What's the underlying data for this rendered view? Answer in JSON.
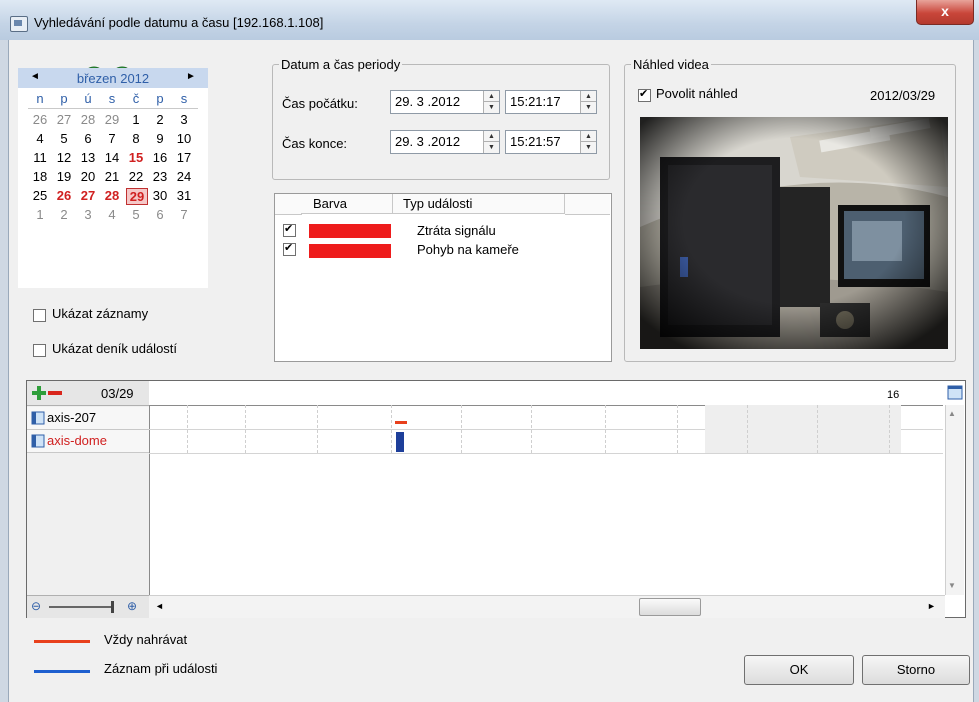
{
  "window": {
    "title": "Vyhledávání podle datumu a času [192.168.1.108]",
    "close_label": "x"
  },
  "toolbar": {
    "icons": [
      "connect-icon",
      "search-icon",
      "back-icon",
      "forward-icon"
    ]
  },
  "calendar": {
    "month": "březen 2012",
    "prev_arrow": "◄",
    "next_arrow": "►",
    "weekdays": [
      "n",
      "p",
      "ú",
      "s",
      "č",
      "p",
      "s"
    ],
    "weeks": [
      [
        "26",
        "27",
        "28",
        "29",
        "1",
        "2",
        "3"
      ],
      [
        "4",
        "5",
        "6",
        "7",
        "8",
        "9",
        "10"
      ],
      [
        "11",
        "12",
        "13",
        "14",
        "15",
        "16",
        "17"
      ],
      [
        "18",
        "19",
        "20",
        "21",
        "22",
        "23",
        "24"
      ],
      [
        "25",
        "26",
        "27",
        "28",
        "29",
        "30",
        "31"
      ],
      [
        "1",
        "2",
        "3",
        "4",
        "5",
        "6",
        "7"
      ]
    ]
  },
  "options": {
    "show_records": "Ukázat záznamy",
    "show_event_log": "Ukázat deník událostí"
  },
  "period": {
    "group_title": "Datum a čas periody",
    "start_label": "Čas počátku:",
    "start_date": "29. 3 .2012",
    "start_time": "15:21:17",
    "end_label": "Čas konce:",
    "end_date": "29. 3 .2012",
    "end_time": "15:21:57"
  },
  "events": {
    "col_color": "Barva",
    "col_type": "Typ události",
    "rows": [
      {
        "name": "Ztráta signálu",
        "color": "#ee1c1c"
      },
      {
        "name": "Pohyb na kameře",
        "color": "#ee1c1c"
      }
    ]
  },
  "video_preview": {
    "group_title": "Náhled videa",
    "enable_label": "Povolit náhled",
    "date": "2012/03/29"
  },
  "timeline": {
    "date": "03/29",
    "tick_label": "16",
    "cameras": [
      "axis-207",
      "axis-dome"
    ]
  },
  "legend": {
    "always_record": "Vždy nahrávat",
    "event_record": "Záznam při události",
    "always_color": "#e8401c",
    "event_color": "#1e5fcf"
  },
  "buttons": {
    "ok": "OK",
    "cancel": "Storno"
  }
}
